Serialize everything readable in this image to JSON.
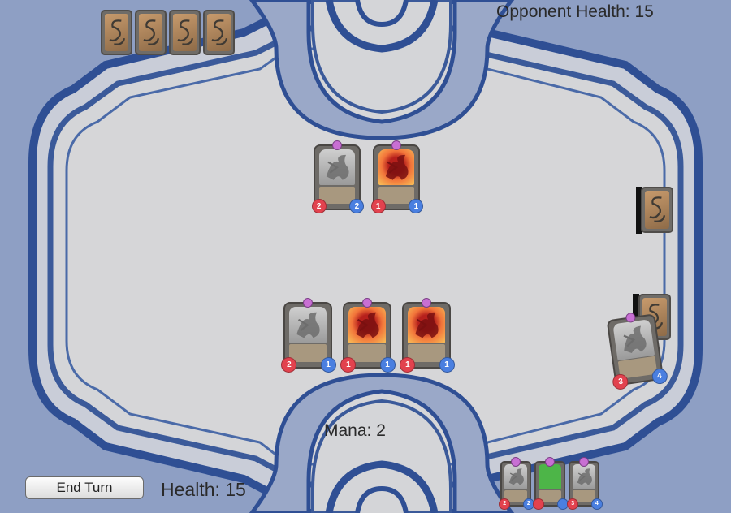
{
  "hud": {
    "opponent_health": "Opponent Health: 15",
    "mana": "Mana: 2",
    "health": "Health: 15",
    "end_turn_label": "End Turn"
  },
  "colors": {
    "background": "#8e9fc4",
    "board": "#d4d5d8",
    "border_dark": "#3b5a9a",
    "attack": "#e2424e",
    "health": "#4a7fe0",
    "mana_gem": "#c86fd3"
  },
  "opponent_hand": {
    "count": 4,
    "icon": "card-back-icon"
  },
  "opponent_board": [
    {
      "art": "gray-dragon",
      "attack": "2",
      "health": "2"
    },
    {
      "art": "red-dragon",
      "attack": "1",
      "health": "1"
    }
  ],
  "player_board": [
    {
      "art": "gray-dragon",
      "attack": "2",
      "health": "1"
    },
    {
      "art": "red-dragon",
      "attack": "1",
      "health": "1"
    },
    {
      "art": "red-dragon",
      "attack": "1",
      "health": "1"
    }
  ],
  "deck": {
    "icon": "card-back-icon"
  },
  "drawn_card": {
    "art": "gray-dragon",
    "attack": "3",
    "health": "4"
  },
  "player_hand": [
    {
      "art": "gray-dragon",
      "attack": "2",
      "health": "2"
    },
    {
      "art": "green",
      "attack": "",
      "health": ""
    },
    {
      "art": "gray-dragon",
      "attack": "3",
      "health": "4"
    }
  ]
}
